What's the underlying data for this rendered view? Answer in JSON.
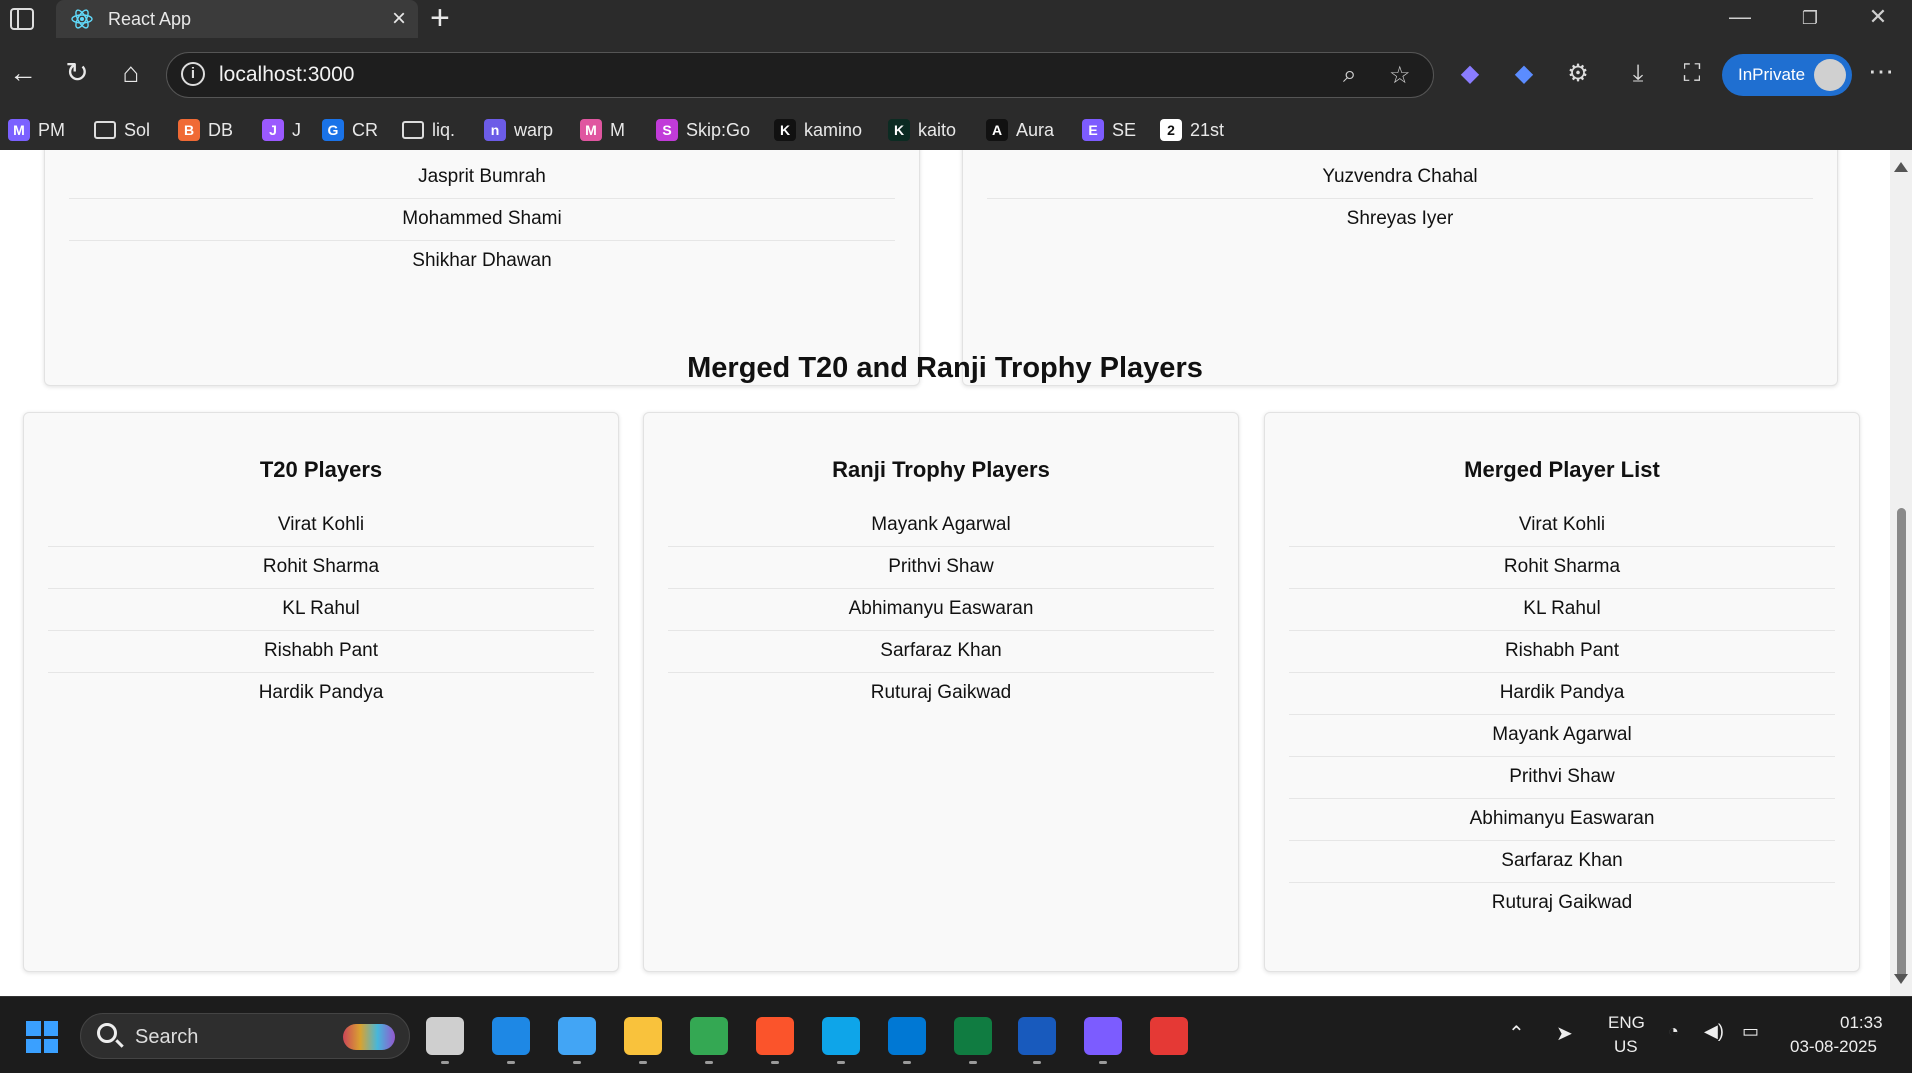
{
  "browser": {
    "tab_title": "React App",
    "url": "localhost:3000",
    "inprivate_label": "InPrivate",
    "bookmarks": [
      {
        "label": "PM",
        "color": "#7b61ff",
        "glyph": "M"
      },
      {
        "label": "Sol",
        "color": "#2b2b2b",
        "glyph": "folder"
      },
      {
        "label": "DB",
        "color": "#f06a35",
        "glyph": "B"
      },
      {
        "label": "J",
        "color": "#9b59ff",
        "glyph": "J"
      },
      {
        "label": "CR",
        "color": "#1a73e8",
        "glyph": "G"
      },
      {
        "label": "liq.",
        "color": "#2b2b2b",
        "glyph": "folder"
      },
      {
        "label": "warp",
        "color": "#6c5ce7",
        "glyph": "n"
      },
      {
        "label": "M",
        "color": "#e056a0",
        "glyph": "M"
      },
      {
        "label": "Skip:Go",
        "color": "#c13bd9",
        "glyph": "S"
      },
      {
        "label": "kamino",
        "color": "#111111",
        "glyph": "K"
      },
      {
        "label": "kaito",
        "color": "#0b2b22",
        "glyph": "K"
      },
      {
        "label": "Aura",
        "color": "#111111",
        "glyph": "A"
      },
      {
        "label": "SE",
        "color": "#7d5cff",
        "glyph": "E"
      },
      {
        "label": "21st",
        "color": "#ffffff",
        "glyph": "2"
      }
    ]
  },
  "page": {
    "top_left_list": [
      "Jasprit Bumrah",
      "Mohammed Shami",
      "Shikhar Dhawan"
    ],
    "top_right_list": [
      "Yuzvendra Chahal",
      "Shreyas Iyer"
    ],
    "section_title": "Merged T20 and Ranji Trophy Players",
    "cards": [
      {
        "title": "T20 Players",
        "players": [
          "Virat Kohli",
          "Rohit Sharma",
          "KL Rahul",
          "Rishabh Pant",
          "Hardik Pandya"
        ]
      },
      {
        "title": "Ranji Trophy Players",
        "players": [
          "Mayank Agarwal",
          "Prithvi Shaw",
          "Abhimanyu Easwaran",
          "Sarfaraz Khan",
          "Ruturaj Gaikwad"
        ]
      },
      {
        "title": "Merged Player List",
        "players": [
          "Virat Kohli",
          "Rohit Sharma",
          "KL Rahul",
          "Rishabh Pant",
          "Hardik Pandya",
          "Mayank Agarwal",
          "Prithvi Shaw",
          "Abhimanyu Easwaran",
          "Sarfaraz Khan",
          "Ruturaj Gaikwad"
        ]
      }
    ]
  },
  "taskbar": {
    "search_label": "Search",
    "lang_line1": "ENG",
    "lang_line2": "US",
    "time": "01:33",
    "date": "03-08-2025",
    "apps": [
      {
        "name": "task-view",
        "color": "#cfcfcf"
      },
      {
        "name": "app-blue",
        "color": "#1e88e5"
      },
      {
        "name": "notepad",
        "color": "#42a5f5"
      },
      {
        "name": "file-explorer",
        "color": "#f9c23c"
      },
      {
        "name": "chrome",
        "color": "#34a853"
      },
      {
        "name": "brave",
        "color": "#fb542b"
      },
      {
        "name": "edge",
        "color": "#0ea5e9"
      },
      {
        "name": "vscode",
        "color": "#0078d4"
      },
      {
        "name": "excel",
        "color": "#107c41"
      },
      {
        "name": "word",
        "color": "#185abd"
      },
      {
        "name": "app-purple",
        "color": "#7c5cff"
      },
      {
        "name": "snipping-tool",
        "color": "#e53935"
      }
    ]
  }
}
